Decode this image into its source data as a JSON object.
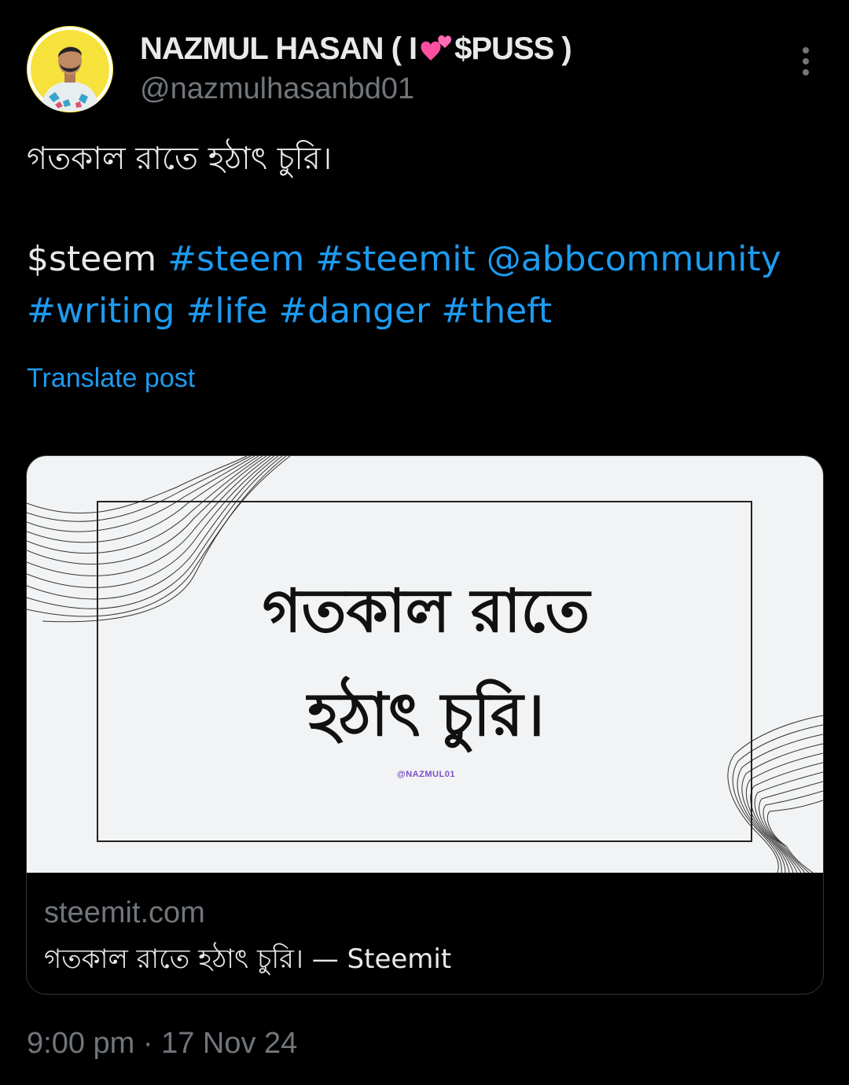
{
  "author": {
    "display_name_start": "NAZMUL HASAN ( I ",
    "display_name_end": "$PUSS )",
    "heart_icon": "two-hearts-emoji",
    "handle": "@nazmulhasanbd01",
    "avatar_bg": "#f6e23a"
  },
  "tweet": {
    "text_line1": "গতকাল রাতে হঠাৎ চুরি।",
    "cashtag_steem": "$steem",
    "tags": {
      "steem": "#steem",
      "steemit": "#steemit",
      "abbcommunity": "@abbcommunity",
      "writing": "#writing",
      "life": "#life",
      "danger": "#danger",
      "theft": "#theft"
    },
    "translate_label": "Translate post"
  },
  "card": {
    "image_title_line1": "গতকাল রাতে",
    "image_title_line2": "হঠাৎ চুরি।",
    "image_credit": "@NAZMUL01",
    "domain": "steemit.com",
    "title": "গতকাল রাতে হঠাৎ চুরি। — Steemit"
  },
  "timestamp": "9:00 pm · 17 Nov 24",
  "colors": {
    "background": "#000000",
    "text": "#e7e9ea",
    "muted": "#71767b",
    "link": "#1d9bf0",
    "border": "#2f3336"
  }
}
